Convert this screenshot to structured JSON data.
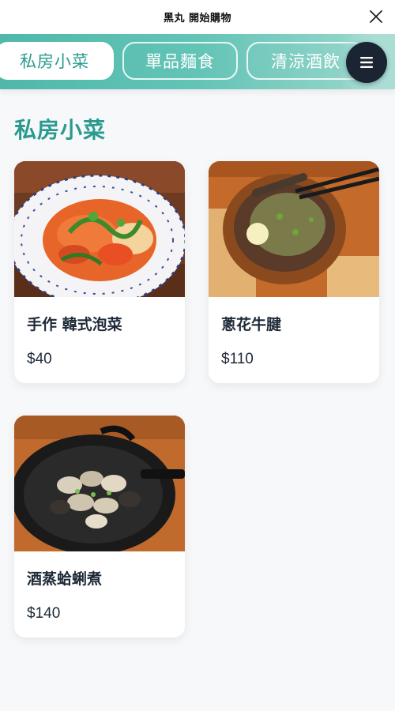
{
  "header": {
    "title": "黑丸 開始購物",
    "close_icon": "close-icon"
  },
  "tabs": [
    {
      "label": "私房小菜",
      "active": true
    },
    {
      "label": "單品麵食",
      "active": false
    },
    {
      "label": "清涼酒飲",
      "active": false
    }
  ],
  "menu_button": {
    "icon": "hamburger-menu-icon"
  },
  "section": {
    "title": "私房小菜"
  },
  "products": [
    {
      "name": "手作 韓式泡菜",
      "price": "$40"
    },
    {
      "name": "蔥花牛腱",
      "price": "$110"
    },
    {
      "name": "酒蒸蛤蜊煮",
      "price": "$140"
    }
  ],
  "colors": {
    "accent": "#2a9a8e",
    "tab_gradient_start": "#4fb8aa",
    "menu_button": "#1a2433"
  }
}
